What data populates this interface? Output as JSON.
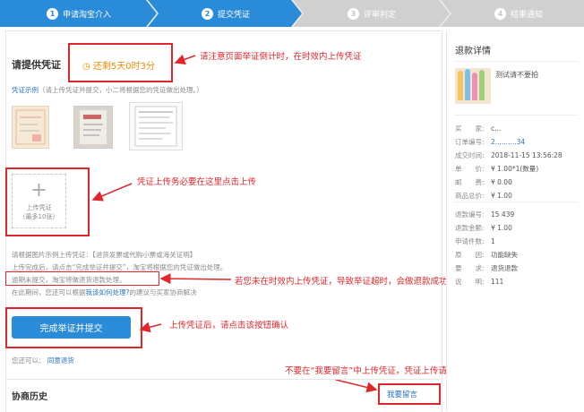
{
  "steps": [
    {
      "num": "1",
      "label": "申请淘宝介入"
    },
    {
      "num": "2",
      "label": "提交凭证"
    },
    {
      "num": "3",
      "label": "评审判定"
    },
    {
      "num": "4",
      "label": "结果通知"
    }
  ],
  "evidence": {
    "title": "请提供凭证",
    "countdown": "还剩5天0时3分",
    "countdown_note": "请注意页面举证倒计时，在时效内上传凭证",
    "example_link": "凭证示例",
    "example_hint": "（请上传凭证并提交，小二将根据您的凭证做出处理。）",
    "upload_label": "上传凭证",
    "upload_limit": "（最多10张）",
    "upload_note": "凭证上传务必要在这里点击上传",
    "instr_line1": "请根据图片示例上传凭证：【进货发票或代购小票或海关证明】",
    "instr_line2": "上传完成后，请点击“完成举证并提交”，淘宝将根据您的凭证做出处理。",
    "instr_line3": "逾期未提交，淘宝将做退货退款处理。",
    "instr_line4_a": "在此期间，您还可以根据",
    "instr_line4_link": "我该如何处理?",
    "instr_line4_b": "的建议与买家协商解决",
    "overdue_note": "若您未在时效内上传凭证，导致举证超时，会做退款成功处理",
    "submit_label": "完成举证并提交",
    "submit_note": "上传凭证后，请点击该按钮确认",
    "also_label": "您还可以：",
    "agree_link": "同意退货",
    "no_message_note": "不要在“我要留言”中上传凭证，凭证上传请看上面",
    "history_title": "协商历史",
    "message_link": "我要留言"
  },
  "sidebar": {
    "title": "退款详情",
    "product_name": "测试请不要拍",
    "rows1": [
      {
        "label": "买　　家:",
        "value": "c..."
      },
      {
        "label": "订单编号:",
        "value": "2..........34",
        "blue": true
      },
      {
        "label": "成交时间:",
        "value": "2018-11-15 13:56:28"
      },
      {
        "label": "单　　价:",
        "value": "¥ 1.00*1(数量)"
      },
      {
        "label": "邮　　费:",
        "value": "¥ 0.00"
      },
      {
        "label": "商品总价:",
        "value": "¥ 1.00"
      }
    ],
    "rows2": [
      {
        "label": "退款编号:",
        "value": "15              439"
      },
      {
        "label": "退款金额:",
        "value": "¥ 1.00"
      },
      {
        "label": "申请件数:",
        "value": "1"
      },
      {
        "label": "原　　因:",
        "value": "功能缺失"
      },
      {
        "label": "要　　求:",
        "value": "退货退款"
      },
      {
        "label": "说　　明:",
        "value": "111"
      }
    ]
  },
  "colors": {
    "accent": "#2a8bd8",
    "annotation": "#e0262a",
    "button": "#2a8bd8",
    "link": "#2a72c8"
  }
}
